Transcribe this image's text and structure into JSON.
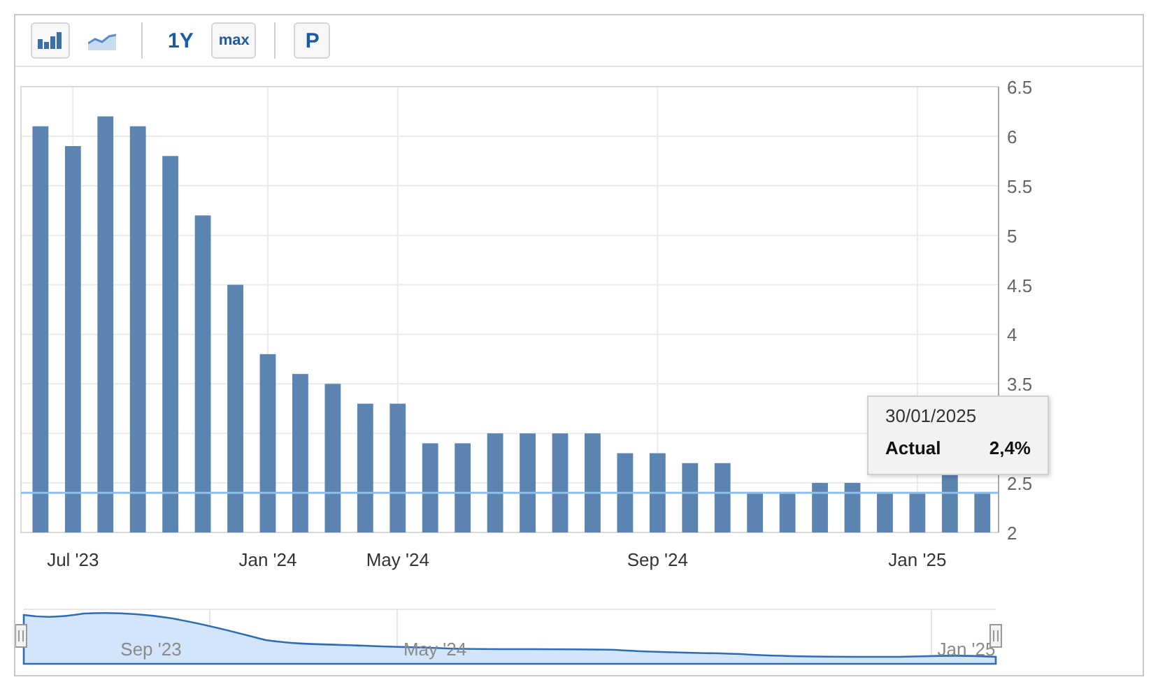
{
  "toolbar": {
    "groups": [
      [
        {
          "kind": "bars",
          "selected": true
        },
        {
          "kind": "line",
          "selected": false
        }
      ],
      [
        {
          "kind": "text",
          "label": "1Y",
          "selected": false
        },
        {
          "kind": "text",
          "label": "max",
          "selected": true
        }
      ],
      [
        {
          "kind": "text",
          "label": "P",
          "selected": true
        }
      ]
    ]
  },
  "chart": {
    "chart_data": {
      "type": "bar",
      "categories": [
        null,
        "Jul '23",
        null,
        null,
        null,
        null,
        null,
        "Jan '24",
        null,
        null,
        null,
        "May '24",
        null,
        null,
        null,
        null,
        null,
        null,
        null,
        "Sep '24",
        null,
        null,
        null,
        null,
        null,
        null,
        null,
        "Jan '25",
        null,
        null
      ],
      "values": [
        6.1,
        5.9,
        6.2,
        6.1,
        5.8,
        5.2,
        4.5,
        3.8,
        3.6,
        3.5,
        3.3,
        3.3,
        2.9,
        2.9,
        3.0,
        3.0,
        3.0,
        3.0,
        2.8,
        2.8,
        2.7,
        2.7,
        2.4,
        2.4,
        2.5,
        2.5,
        2.4,
        2.4,
        2.6,
        2.4
      ],
      "ylim": [
        2,
        6.5
      ],
      "yticks": [
        2,
        2.5,
        3.5,
        4,
        4.5,
        5,
        5.5,
        6,
        6.5
      ],
      "grid": true,
      "ref_lines": [
        {
          "axis": "y",
          "value": 2.4
        }
      ]
    },
    "tooltip": {
      "date": "30/01/2025",
      "label": "Actual",
      "value": "2,4%"
    }
  },
  "navigator": {
    "labels": [
      {
        "text": "Sep '23"
      },
      {
        "text": "May '24"
      },
      {
        "text": "Jan '25"
      }
    ]
  }
}
